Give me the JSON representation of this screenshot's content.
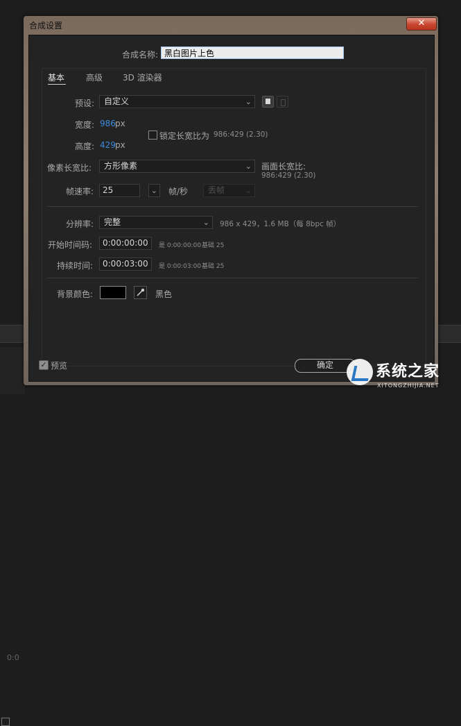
{
  "window": {
    "title": "合成设置",
    "close_label": "✕"
  },
  "composition": {
    "name_label": "合成名称:",
    "name_value": "黑白图片上色"
  },
  "tabs": [
    {
      "label": "基本",
      "active": true
    },
    {
      "label": "高级",
      "active": false
    },
    {
      "label": "3D 渲染器",
      "active": false
    }
  ],
  "basic": {
    "preset_label": "预设:",
    "preset_value": "自定义",
    "width_label": "宽度:",
    "width_value": "986",
    "width_unit": "px",
    "height_label": "高度:",
    "height_value": "429",
    "height_unit": "px",
    "lock_aspect_label": "锁定长宽比为",
    "lock_aspect_value": "986:429 (2.30)",
    "lock_aspect_checked": false,
    "pixel_aspect_label": "像素长宽比:",
    "pixel_aspect_value": "方形像素",
    "frame_aspect_label": "画面长宽比:",
    "frame_aspect_value": "986:429 (2.30)",
    "frame_rate_label": "帧速率:",
    "frame_rate_value": "25",
    "frame_rate_unit": "帧/秒",
    "drop_frame_value": "丢帧",
    "resolution_label": "分辨率:",
    "resolution_value": "完整",
    "resolution_info": "986 x 429，1.6 MB（每 8bpc 帧）",
    "start_timecode_label": "开始时间码:",
    "start_timecode_value": "0:00:00:00",
    "start_timecode_is": "是 0:00:00:00",
    "start_timecode_base": "基础 25",
    "duration_label": "持续时间:",
    "duration_value": "0:00:03:00",
    "duration_is": "是 0:00:03:00",
    "duration_base": "基础 25",
    "bg_color_label": "背景颜色:",
    "bg_color_name": "黑色",
    "bg_color_hex": "#000000"
  },
  "footer": {
    "preview_label": "预览",
    "preview_checked": true,
    "ok_label": "确定"
  },
  "watermark": {
    "text": "系统之家",
    "url": "XITONGZHIJIA.NET"
  },
  "background": {
    "timecode_fragment": "0:0"
  },
  "colors": {
    "accent_value": "#3c8bdc",
    "titlebar": "#8d7d70",
    "close_button": "#c8452f",
    "dialog_bg": "#232323"
  }
}
